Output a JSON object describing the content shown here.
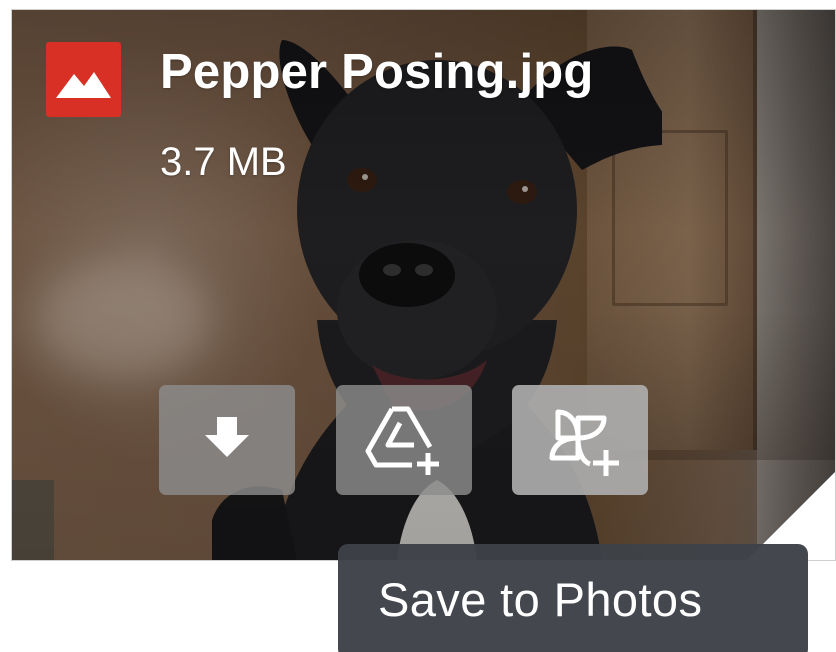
{
  "attachment": {
    "file_name": "Pepper Posing.jpg",
    "file_size": "3.7 MB",
    "file_type_icon": "image-file-icon",
    "file_type_color": "#d93025"
  },
  "actions": [
    {
      "icon": "download-icon"
    },
    {
      "icon": "add-to-drive-icon"
    },
    {
      "icon": "add-to-photos-icon"
    }
  ],
  "tooltip": {
    "text": "Save to Photos"
  }
}
